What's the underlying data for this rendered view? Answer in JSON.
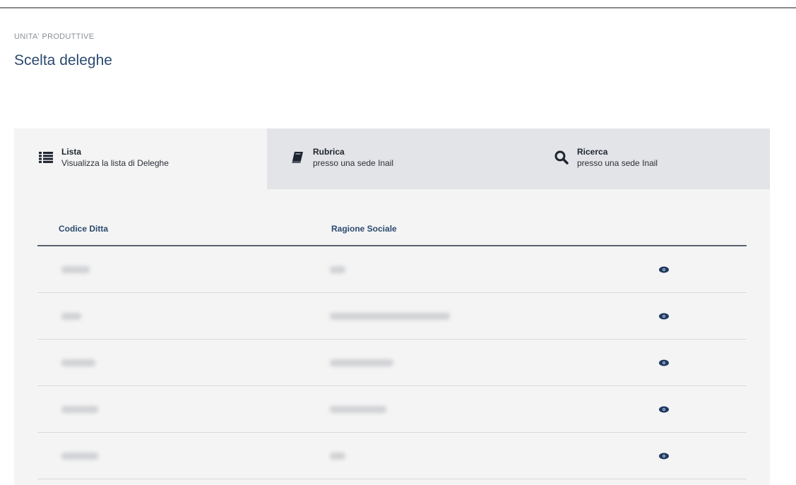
{
  "header": {
    "breadcrumb": "UNITA' PRODUTTIVE",
    "title": "Scelta deleghe"
  },
  "tabs": [
    {
      "title": "Lista",
      "subtitle": "Visualizza la lista di Deleghe",
      "icon": "list-icon",
      "active": true
    },
    {
      "title": "Rubrica",
      "subtitle": "presso una sede Inail",
      "icon": "book-icon",
      "active": false
    },
    {
      "title": "Ricerca",
      "subtitle": "presso una sede Inail",
      "icon": "search-icon",
      "active": false
    }
  ],
  "table": {
    "columns": [
      "Codice Ditta",
      "Ragione Sociale"
    ],
    "rows_note_hidden": true
  },
  "colors": {
    "accent": "#2b4a6f",
    "panel_bg": "#f4f4f4",
    "tab_inactive_bg": "#e3e4e7"
  }
}
